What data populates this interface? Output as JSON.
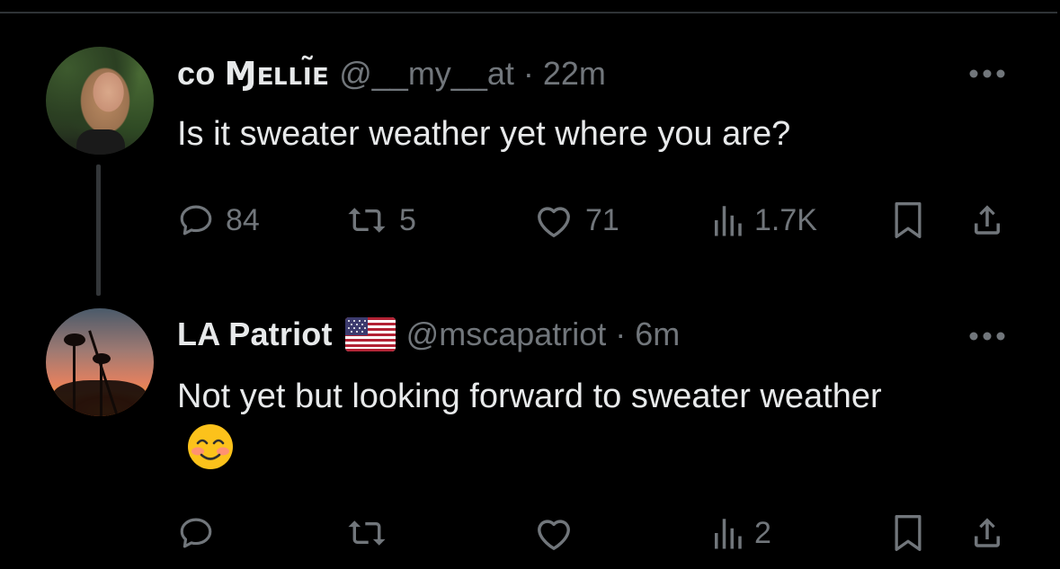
{
  "tweets": [
    {
      "display_name": "ᴄᴏ Ɱᴇʟʟı̃ᴇ",
      "handle_time": "@__my__at · 22m",
      "text": "Is it sweater weather yet where you are?",
      "replies": "84",
      "reposts": "5",
      "likes": "71",
      "views": "1.7K"
    },
    {
      "display_name": "LA Patriot",
      "flag": "us-flag",
      "handle_time": "@mscapatriot · 6m",
      "text": "Not yet but looking forward to sweater weather",
      "emoji": "smiling-face-with-smiling-eyes",
      "replies": "",
      "reposts": "",
      "likes": "",
      "views": "2"
    }
  ],
  "icons": {
    "reply": "speech-bubble-icon",
    "repost": "repost-arrows-icon",
    "like": "heart-icon",
    "views": "bar-chart-icon",
    "bookmark": "bookmark-icon",
    "share": "share-upload-icon",
    "more": "more-dots-icon"
  },
  "colors": {
    "background": "#000000",
    "primary_text": "#e7e9ea",
    "secondary_text": "#71767b",
    "divider": "#2f3336"
  }
}
